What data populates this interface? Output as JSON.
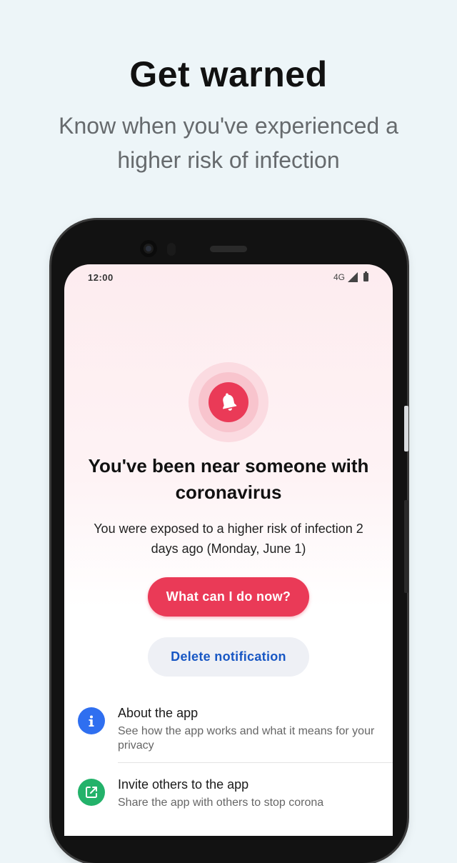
{
  "hero": {
    "title": "Get warned",
    "subtitle": "Know when you've experienced a higher risk of infection"
  },
  "status_bar": {
    "time": "12:00",
    "network": "4G",
    "icons": [
      "signal-icon",
      "battery-icon"
    ]
  },
  "alert": {
    "icon": "bell-icon",
    "title": "You've been near someone with coronavirus",
    "body": "You were exposed to a higher risk of infection 2 days ago (Monday, June 1)",
    "primary_button": "What can I do now?",
    "secondary_button": "Delete notification"
  },
  "menu": [
    {
      "icon": "info-icon",
      "title": "About the app",
      "description": "See how the app works and what it means for your privacy"
    },
    {
      "icon": "share-icon",
      "title": "Invite others to the app",
      "description": "Share the app with others to stop corona"
    }
  ],
  "colors": {
    "background": "#edf5f8",
    "accent_red": "#ea3a57",
    "link_blue": "#1857c4",
    "info_blue": "#2f6ff0",
    "share_green": "#23b26a"
  }
}
